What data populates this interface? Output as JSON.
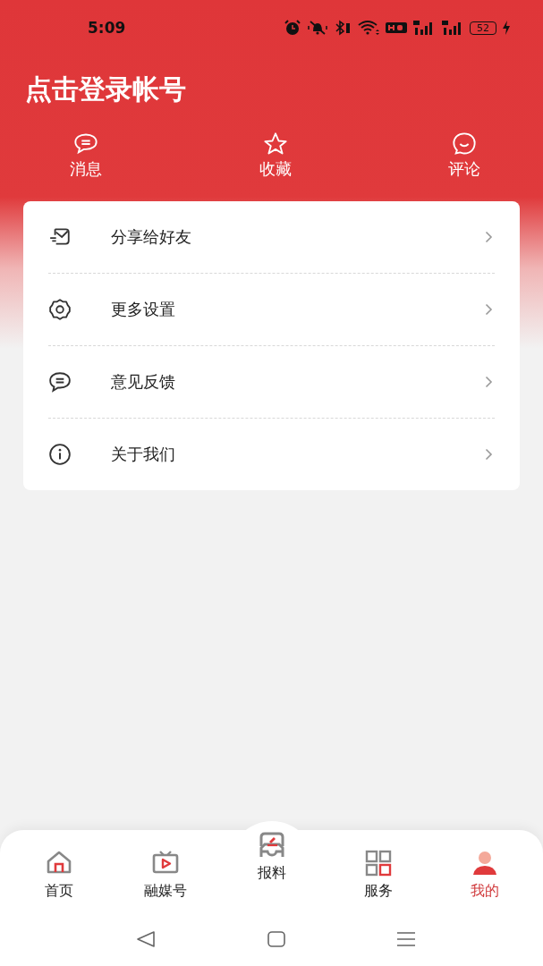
{
  "status_bar": {
    "time": "5:09",
    "battery": "52"
  },
  "header": {
    "title": "点击登录帐号"
  },
  "quick_actions": [
    {
      "label": "消息"
    },
    {
      "label": "收藏"
    },
    {
      "label": "评论"
    }
  ],
  "menu": [
    {
      "label": "分享给好友"
    },
    {
      "label": "更多设置"
    },
    {
      "label": "意见反馈"
    },
    {
      "label": "关于我们"
    }
  ],
  "tab_bar": [
    {
      "label": "首页",
      "selected": false
    },
    {
      "label": "融媒号",
      "selected": false
    },
    {
      "label": "报料",
      "selected": false,
      "kind": "raised"
    },
    {
      "label": "服务",
      "selected": false
    },
    {
      "label": "我的",
      "selected": true
    }
  ]
}
